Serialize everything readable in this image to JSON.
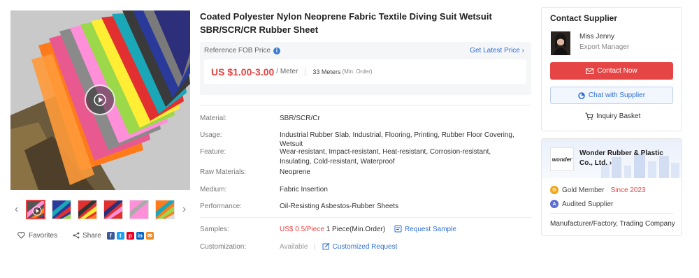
{
  "gallery": {
    "thumb_count": 6,
    "favorites_label": "Favorites",
    "share_label": "Share",
    "social": [
      {
        "name": "facebook-icon",
        "glyph": "f",
        "color": "#3b5998"
      },
      {
        "name": "twitter-icon",
        "glyph": "t",
        "color": "#1da1f2"
      },
      {
        "name": "pinterest-icon",
        "glyph": "p",
        "color": "#e60023"
      },
      {
        "name": "linkedin-icon",
        "glyph": "in",
        "color": "#0a66c2"
      },
      {
        "name": "email-icon",
        "glyph": "✉",
        "color": "#f08a24"
      }
    ]
  },
  "product": {
    "title": "Coated Polyester Nylon Neoprene Fabric Textile Diving Suit Wetsuit SBR/SCR/CR Rubber Sheet",
    "price_label": "Reference FOB Price",
    "latest_price_link": "Get Latest Price",
    "price": "US $1.00-3.00",
    "price_unit": "/ Meter",
    "moq": "33 Meters",
    "moq_label": "(Min. Order)",
    "attributes": [
      {
        "key": "Material:",
        "value": "SBR/SCR/Cr"
      },
      {
        "key": "Usage:",
        "value": "Industrial Rubber Slab, Industrial, Flooring, Printing, Rubber Floor Covering, Wetsuit"
      },
      {
        "key": "Feature:",
        "value": "Wear-resistant, Impact-resistant, Heat-resistant, Corrosion-resistant, Insulating, Cold-resistant, Waterproof"
      },
      {
        "key": "Raw Materials:",
        "value": "Neoprene"
      },
      {
        "key": "Medium:",
        "value": "Fabric Insertion"
      },
      {
        "key": "Performance:",
        "value": "Oil-Resisting Asbestos-Rubber Sheets"
      }
    ],
    "samples": {
      "key": "Samples:",
      "price": "US$ 0.5/Piece",
      "qty": "1 Piece(Min.Order)",
      "link": "Request Sample"
    },
    "customization": {
      "key": "Customization:",
      "status": "Available",
      "link": "Customized Request"
    }
  },
  "supplier": {
    "heading": "Contact Supplier",
    "person_name": "Miss Jenny",
    "person_role": "Export Manager",
    "contact_btn": "Contact Now",
    "chat_btn": "Chat with Supplier",
    "basket": "Inquiry Basket",
    "logo_text": "wonder",
    "company": "Wonder Rubber & Plastic Co., Ltd.",
    "gold_label": "Gold Member",
    "since": "Since 2023",
    "audited": "Audited Supplier",
    "business_type": "Manufacturer/Factory, Trading Company"
  },
  "colors": {
    "accent_red": "#e64545",
    "link_blue": "#2f6fd1"
  }
}
